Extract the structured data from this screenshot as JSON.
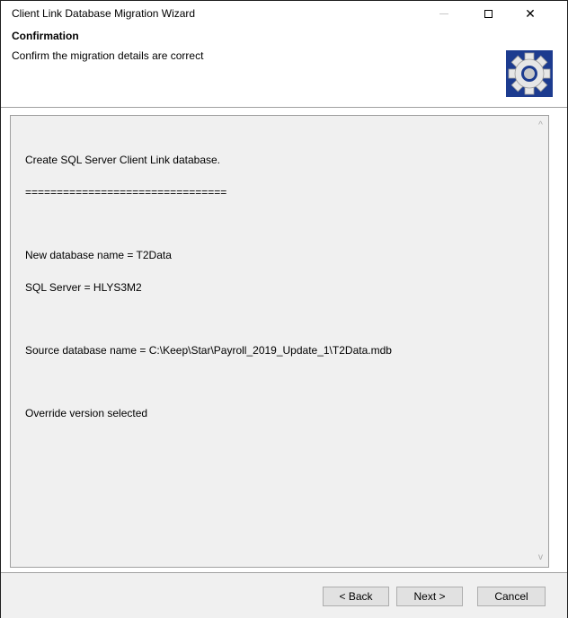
{
  "window": {
    "title": "Client Link Database Migration Wizard",
    "close_glyph": "✕"
  },
  "header": {
    "title": "Confirmation",
    "subtitle": "Confirm the migration details are correct",
    "icon": "gear-icon"
  },
  "details": {
    "heading": "Create SQL Server Client Link database.",
    "underline": "================================",
    "new_db": "New database name = T2Data",
    "sql_server": "SQL Server = HLYS3M2",
    "source_db": "Source database name = C:\\Keep\\Star\\Payroll_2019_Update_1\\T2Data.mdb",
    "override": "Override version selected"
  },
  "scroll": {
    "up": "^",
    "down": "v"
  },
  "buttons": {
    "back": "< Back",
    "next": "Next >",
    "cancel": "Cancel"
  },
  "colors": {
    "content_bg": "#f0f0f0",
    "gear_bg": "#1c3b8f"
  }
}
